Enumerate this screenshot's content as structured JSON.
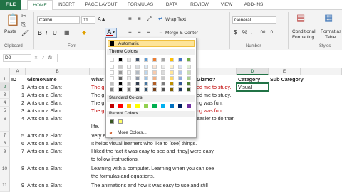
{
  "tabs": [
    "FILE",
    "HOME",
    "INSERT",
    "PAGE LAYOUT",
    "FORMULAS",
    "DATA",
    "REVIEW",
    "VIEW",
    "ADD-INS"
  ],
  "ribbon": {
    "paste_label": "Paste",
    "clipboard_label": "Clipboard",
    "font_name": "Calibri",
    "font_size": "11",
    "font_group_label": "Font",
    "wrap_text_label": "Wrap Text",
    "merge_label": "Merge & Center",
    "number_format": "General",
    "number_group_label": "Number",
    "conditional_label": "Conditional",
    "formatting_label": "Formatting",
    "format_as_label": "Format as",
    "table_label": "Table",
    "styles_label": "Styles",
    "bold": "B",
    "italic": "I",
    "underline": "U"
  },
  "formula_bar": {
    "name_box": "D2",
    "fx": "fx"
  },
  "columns": [
    "A",
    "B",
    "C",
    "D",
    "E"
  ],
  "column_header_row": [
    "ID",
    "GizmoName",
    "What did you like about this Gizmo?",
    "Category",
    "Sub Category"
  ],
  "rows": [
    {
      "num": "1",
      "id": "",
      "name": "",
      "text": "",
      "cat": "",
      "sub": ""
    },
    {
      "num": "2",
      "id": "1",
      "name": "Ants on a Slant",
      "text": "The g... ed me to study.",
      "cat": "Visual",
      "sub": ""
    },
    {
      "num": "3",
      "id": "1",
      "name": "Ants on a Slant",
      "text": "The g... ed me to study.",
      "cat": "",
      "sub": ""
    },
    {
      "num": "4",
      "id": "2",
      "name": "Ants on a Slant",
      "text": "The g... ng was fun.",
      "cat": "",
      "sub": ""
    },
    {
      "num": "5",
      "id": "3",
      "name": "Ants on a Slant",
      "text": "The g... ng was fun.",
      "cat": "",
      "sub": ""
    },
    {
      "num": "6",
      "id": "4",
      "name": "Ants on a Slant",
      "text": "easier to do than real life.",
      "cat": "",
      "sub": ""
    },
    {
      "num": "7",
      "id": "5",
      "name": "Ants on a Slant",
      "text": "Very easy to use.",
      "cat": "",
      "sub": ""
    },
    {
      "num": "8",
      "id": "6",
      "name": "Ants on a Slant",
      "text": "It helps visual learners who like to [see] things.",
      "cat": "",
      "sub": ""
    },
    {
      "num": "9",
      "id": "7",
      "name": "Ants on a Slant",
      "text": "I liked the fact it was easy to see and [they] were easy to follow instructions.",
      "cat": "",
      "sub": ""
    },
    {
      "num": "10",
      "id": "8",
      "name": "Ants on a Slant",
      "text": "Learning with a computer.  Learning when you can see the formulas and equations.",
      "cat": "",
      "sub": ""
    },
    {
      "num": "11",
      "id": "9",
      "name": "Ants on a Slant",
      "text": "The animations and how it was easy to use and still",
      "cat": "",
      "sub": ""
    }
  ],
  "cells": {
    "r2c": "The g",
    "r2c_tail": "ed me to study.",
    "r3c": "The g",
    "r3c_tail": "ed me to study.",
    "r4c": "The g",
    "r4c_tail": "ng was fun.",
    "r5c": "The g",
    "r5c_tail": "ng was fun.",
    "r6c_tail": "easier to do than real",
    "r6c_wrap": "life.",
    "r7c": "Very easy to use.",
    "r8c": "It helps visual learners who like to [see] things.",
    "r9c1": "I liked the fact it was easy to see and [they] were easy",
    "r9c2": "to follow instructions.",
    "r10c1": "Learning with a computer.  Learning when you can see",
    "r10c2": "the formulas and equations.",
    "r11c": "The animations and how it was easy to use and still",
    "header_c": "What",
    "header_c_tail": "Gizmo?"
  },
  "color_popup": {
    "automatic": "Automatic",
    "theme_colors": "Theme Colors",
    "standard_colors": "Standard Colors",
    "recent_colors": "Recent Colors",
    "more_colors": "More Colors...",
    "theme_top": [
      "#ffffff",
      "#000000",
      "#e7e6e6",
      "#44546a",
      "#5b9bd5",
      "#ed7d31",
      "#a5a5a5",
      "#ffc000",
      "#4472c4",
      "#70ad47"
    ],
    "standard": [
      "#c00000",
      "#ff0000",
      "#ffc000",
      "#ffff00",
      "#92d050",
      "#00b050",
      "#00b0f0",
      "#0070c0",
      "#002060",
      "#7030a0"
    ],
    "recent": [
      "#375623",
      "#ffff66"
    ]
  }
}
